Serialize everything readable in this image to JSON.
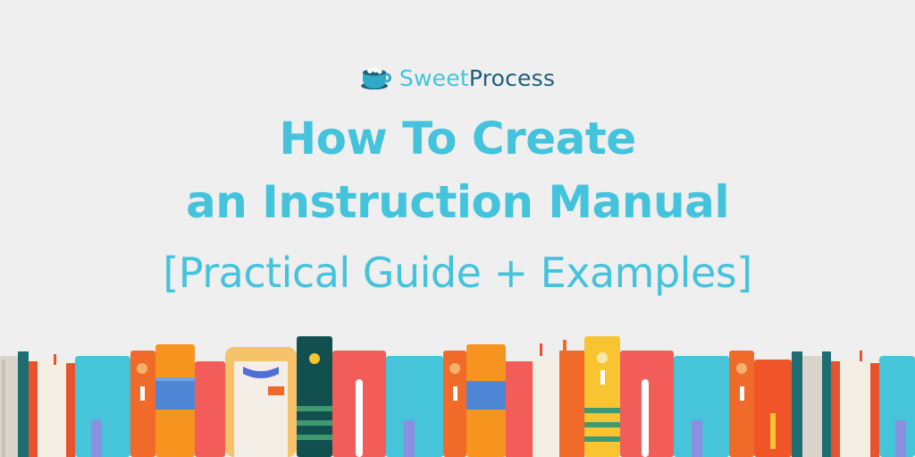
{
  "brand": {
    "name_part1": "Sweet",
    "name_part2": "Process",
    "logo_icon": "coffee-mug-logo"
  },
  "heading": {
    "line1": "How To Create",
    "line2": "an Instruction Manual",
    "subtitle": "[Practical Guide + Examples]"
  },
  "colors": {
    "background": "#efefef",
    "accent": "#44c3dc",
    "brand_dark": "#1b5f7d"
  },
  "illustration": "books-on-shelf"
}
